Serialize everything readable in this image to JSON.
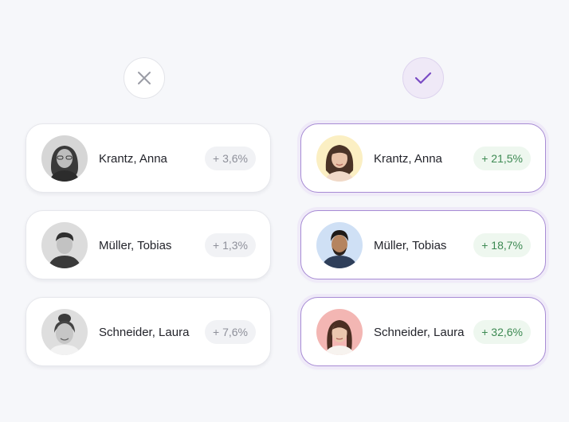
{
  "columns": {
    "left": {
      "verdict": "reject",
      "icon": "close-icon",
      "rows": [
        {
          "name": "Krantz, Anna",
          "change": "+ 3,6%"
        },
        {
          "name": "Müller, Tobias",
          "change": "+ 1,3%"
        },
        {
          "name": "Schneider, Laura",
          "change": "+ 7,6%"
        }
      ]
    },
    "right": {
      "verdict": "accept",
      "icon": "check-icon",
      "rows": [
        {
          "name": "Krantz, Anna",
          "change": "+ 21,5%"
        },
        {
          "name": "Müller, Tobias",
          "change": "+ 18,7%"
        },
        {
          "name": "Schneider, Laura",
          "change": "+ 32,6%"
        }
      ]
    }
  },
  "colors": {
    "accent_purple": "#7a4bc4",
    "positive_green": "#3d8a53",
    "muted_gray": "#8e909a",
    "avatar_bg_yellow": "#fbefc3",
    "avatar_bg_blue": "#cfe0f5",
    "avatar_bg_pink": "#f3b6b3"
  }
}
